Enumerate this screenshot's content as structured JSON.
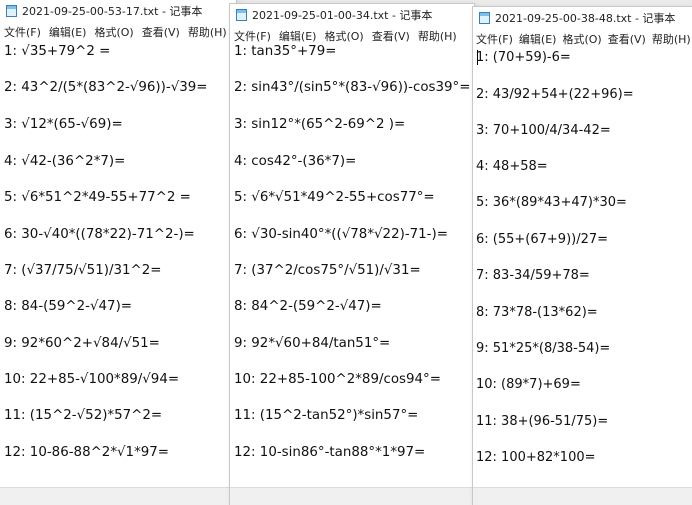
{
  "menu_labels": [
    "文件(F)",
    "编辑(E)",
    "格式(O)",
    "查看(V)",
    "帮助(H)"
  ],
  "windows": [
    {
      "title": "2021-09-25-00-53-17.txt - 记事本",
      "lines": [
        "1: √35+79^2 =",
        "2: 43^2/(5*(83^2-√96))-√39=",
        "3: √12*(65-√69)=",
        "4: √42-(36^2*7)=",
        "5: √6*51^2*49-55+77^2 =",
        "6: 30-√40*((78*22)-71^2-)=",
        "7: (√37/75/√51)/31^2=",
        "8: 84-(59^2-√47)=",
        "9: 92*60^2+√84/√51=",
        "10: 22+85-√100*89/√94=",
        "11: (15^2-√52)*57^2=",
        "12: 10-86-88^2*√1*97="
      ]
    },
    {
      "title": "2021-09-25-01-00-34.txt - 记事本",
      "lines": [
        "1: tan35°+79=",
        "2: sin43°/(sin5°*(83-√96))-cos39°=",
        "3: sin12°*(65^2-69^2 )=",
        "4: cos42°-(36*7)=",
        "5: √6*√51*49^2-55+cos77°=",
        "6: √30-sin40°*((√78*√22)-71-)=",
        "7: (37^2/cos75°/√51)/√31=",
        "8: 84^2-(59^2-√47)=",
        "9: 92*√60+84/tan51°=",
        "10: 22+85-100^2*89/cos94°=",
        "11: (15^2-tan52°)*sin57°=",
        "12: 10-sin86°-tan88°*1*97="
      ]
    },
    {
      "title": "2021-09-25-00-38-48.txt - 记事本",
      "lines": [
        "1: (70+59)-6=",
        "2: 43/92+54+(22+96)=",
        "3: 70+100/4/34-42=",
        "4: 48+58=",
        "5: 36*(89*43+47)*30=",
        "6: (55+(67+9))/27=",
        "7: 83-34/59+78=",
        "8: 73*78-(13*62)=",
        "9: 51*25*(8/38-54)=",
        "10: (89*7)+69=",
        "11: 38+(96-51/75)=",
        "12: 100+82*100="
      ]
    }
  ]
}
